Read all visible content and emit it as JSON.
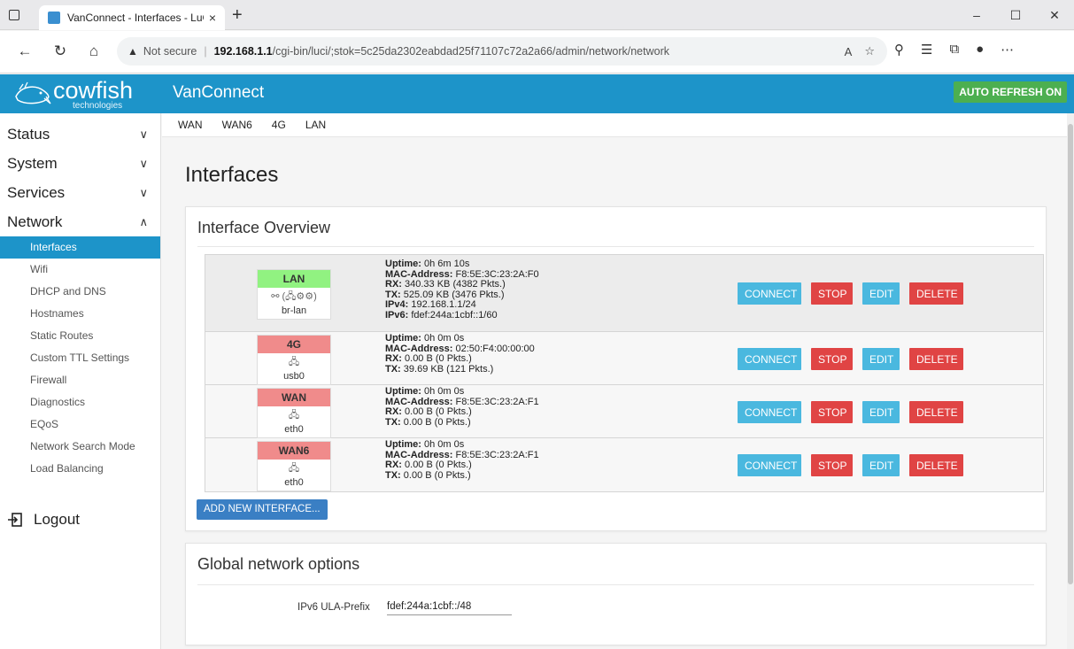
{
  "browser": {
    "tab_title": "VanConnect - Interfaces - LuCI",
    "tab_close": "×",
    "new_tab": "+",
    "not_secure": "Not secure",
    "url_host": "192.168.1.1",
    "url_path": "/cgi-bin/luci/;stok=5c25da2302eabdad25f71107c72a2a66/admin/network/network",
    "window_controls": [
      "–",
      "☐",
      "✕"
    ]
  },
  "header": {
    "logo_word": "cowfish",
    "logo_sub": "technologies",
    "brand": "VanConnect",
    "auto_refresh": "AUTO REFRESH ON",
    "color": "#1d94c9"
  },
  "sidebar": {
    "menus": [
      {
        "label": "Status",
        "chevron": "∨"
      },
      {
        "label": "System",
        "chevron": "∨"
      },
      {
        "label": "Services",
        "chevron": "∨"
      },
      {
        "label": "Network",
        "chevron": "∧"
      }
    ],
    "network_items": [
      {
        "label": "Interfaces",
        "active": true
      },
      {
        "label": "Wifi"
      },
      {
        "label": "DHCP and DNS"
      },
      {
        "label": "Hostnames"
      },
      {
        "label": "Static Routes"
      },
      {
        "label": "Custom TTL Settings"
      },
      {
        "label": "Firewall"
      },
      {
        "label": "Diagnostics"
      },
      {
        "label": "EQoS"
      },
      {
        "label": "Network Search Mode"
      },
      {
        "label": "Load Balancing"
      }
    ],
    "logout": "Logout"
  },
  "subnav": [
    "WAN",
    "WAN6",
    "4G",
    "LAN"
  ],
  "page_title": "Interfaces",
  "overview": {
    "title": "Interface Overview",
    "button_labels": {
      "connect": "CONNECT",
      "stop": "STOP",
      "edit": "EDIT",
      "delete": "DELETE"
    },
    "add_button": "ADD NEW INTERFACE...",
    "interfaces": [
      {
        "name": "LAN",
        "status": "up",
        "icons": "⚯ (🖧⚙⚙)",
        "device": "br-lan",
        "info": [
          [
            "Uptime:",
            "0h 6m 10s"
          ],
          [
            "MAC-Address:",
            "F8:5E:3C:23:2A:F0"
          ],
          [
            "RX:",
            "340.33 KB (4382 Pkts.)"
          ],
          [
            "TX:",
            "525.09 KB (3476 Pkts.)"
          ],
          [
            "IPv4:",
            "192.168.1.1/24"
          ],
          [
            "IPv6:",
            "fdef:244a:1cbf::1/60"
          ]
        ]
      },
      {
        "name": "4G",
        "status": "down",
        "icons": "🖧",
        "device": "usb0",
        "info": [
          [
            "Uptime:",
            "0h 0m 0s"
          ],
          [
            "MAC-Address:",
            "02:50:F4:00:00:00"
          ],
          [
            "RX:",
            "0.00 B (0 Pkts.)"
          ],
          [
            "TX:",
            "39.69 KB (121 Pkts.)"
          ]
        ]
      },
      {
        "name": "WAN",
        "status": "down",
        "icons": "🖧",
        "device": "eth0",
        "info": [
          [
            "Uptime:",
            "0h 0m 0s"
          ],
          [
            "MAC-Address:",
            "F8:5E:3C:23:2A:F1"
          ],
          [
            "RX:",
            "0.00 B (0 Pkts.)"
          ],
          [
            "TX:",
            "0.00 B (0 Pkts.)"
          ]
        ]
      },
      {
        "name": "WAN6",
        "status": "down",
        "icons": "🖧",
        "device": "eth0",
        "info": [
          [
            "Uptime:",
            "0h 0m 0s"
          ],
          [
            "MAC-Address:",
            "F8:5E:3C:23:2A:F1"
          ],
          [
            "RX:",
            "0.00 B (0 Pkts.)"
          ],
          [
            "TX:",
            "0.00 B (0 Pkts.)"
          ]
        ]
      }
    ]
  },
  "global": {
    "title": "Global network options",
    "ula_label": "IPv6 ULA-Prefix",
    "ula_value": "fdef:244a:1cbf::/48"
  }
}
